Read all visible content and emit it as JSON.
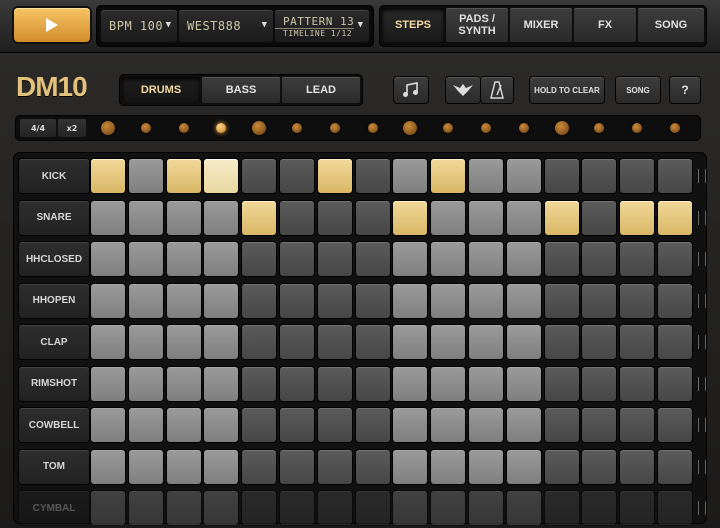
{
  "transport": {
    "play_icon": "play-icon"
  },
  "displays": {
    "bpm": "BPM 100",
    "style": "WEST888",
    "pattern": "PATTERN 13",
    "timeline": "TIMELINE 1/12"
  },
  "main_tabs": [
    "STEPS",
    "PADS / SYNTH",
    "MIXER",
    "FX",
    "SONG"
  ],
  "active_main_tab": "STEPS",
  "logo": "DM10",
  "instrument_tabs": [
    "DRUMS",
    "BASS",
    "LEAD"
  ],
  "active_instrument_tab": "DRUMS",
  "toolbar": {
    "hold_to_clear": "HOLD TO CLEAR",
    "song": "SONG",
    "help": "?",
    "note_icon": "music-note-icon",
    "eagle_icon": "eagle-icon",
    "metronome_icon": "metronome-icon"
  },
  "time_signature": "4/4",
  "multiplier": "x2",
  "current_step": 4,
  "rows": [
    {
      "name": "KICK",
      "active": [
        1,
        3,
        4,
        7,
        10
      ],
      "highlight": [
        4
      ]
    },
    {
      "name": "SNARE",
      "active": [
        5,
        9,
        13,
        15,
        16
      ],
      "highlight": []
    },
    {
      "name": "HHCLOSED",
      "active": [],
      "highlight": []
    },
    {
      "name": "HHOPEN",
      "active": [],
      "highlight": []
    },
    {
      "name": "CLAP",
      "active": [],
      "highlight": []
    },
    {
      "name": "RIMSHOT",
      "active": [],
      "highlight": []
    },
    {
      "name": "COWBELL",
      "active": [],
      "highlight": []
    },
    {
      "name": "TOM",
      "active": [],
      "highlight": []
    },
    {
      "name": "CYMBAL",
      "active": [],
      "highlight": []
    }
  ],
  "colors": {
    "accent": "#e2c17b",
    "step_on": "#e6c774",
    "step_light": "#8c8c8c",
    "step_dark": "#505050"
  }
}
